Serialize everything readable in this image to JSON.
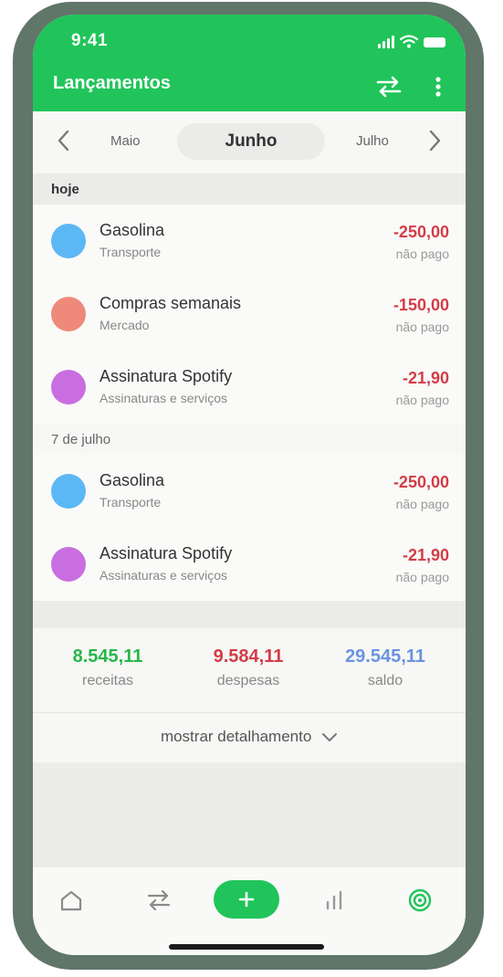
{
  "status_bar": {
    "time": "9:41"
  },
  "app_bar": {
    "title": "Lançamentos"
  },
  "month_selector": {
    "previous": "Maio",
    "current": "Junho",
    "next": "Julho"
  },
  "sections": [
    {
      "label": "hoje"
    },
    {
      "label": "7 de julho"
    }
  ],
  "transactions": [
    {
      "name": "Gasolina",
      "category": "Transporte",
      "amount": "-250,00",
      "status": "não pago",
      "color": "#5cb8f5"
    },
    {
      "name": "Compras semanais",
      "category": "Mercado",
      "amount": "-150,00",
      "status": "não pago",
      "color": "#ef8a7a"
    },
    {
      "name": "Assinatura Spotify",
      "category": "Assinaturas e serviços",
      "amount": "-21,90",
      "status": "não pago",
      "color": "#c96ee0"
    },
    {
      "name": "Gasolina",
      "category": "Transporte",
      "amount": "-250,00",
      "status": "não pago",
      "color": "#5cb8f5"
    },
    {
      "name": "Assinatura Spotify",
      "category": "Assinaturas e serviços",
      "amount": "-21,90",
      "status": "não pago",
      "color": "#c96ee0"
    }
  ],
  "summary": {
    "income": {
      "value": "8.545,11",
      "label": "receitas",
      "color": "#27b74a"
    },
    "expenses": {
      "value": "9.584,11",
      "label": "despesas",
      "color": "#d23d47"
    },
    "balance": {
      "value": "29.545,11",
      "label": "saldo",
      "color": "#6b93e0"
    }
  },
  "details_toggle": {
    "label": "mostrar detalhamento"
  },
  "bottom_nav": {
    "items": [
      {
        "icon": "home-icon"
      },
      {
        "icon": "transfer-icon"
      },
      {
        "icon": "plus-icon"
      },
      {
        "icon": "bar-chart-icon"
      },
      {
        "icon": "target-icon",
        "active_color": "#21c45a"
      }
    ]
  },
  "colors": {
    "accent": "#21c45a",
    "negative": "#d23d47",
    "phone_frame": "#5f7668"
  }
}
